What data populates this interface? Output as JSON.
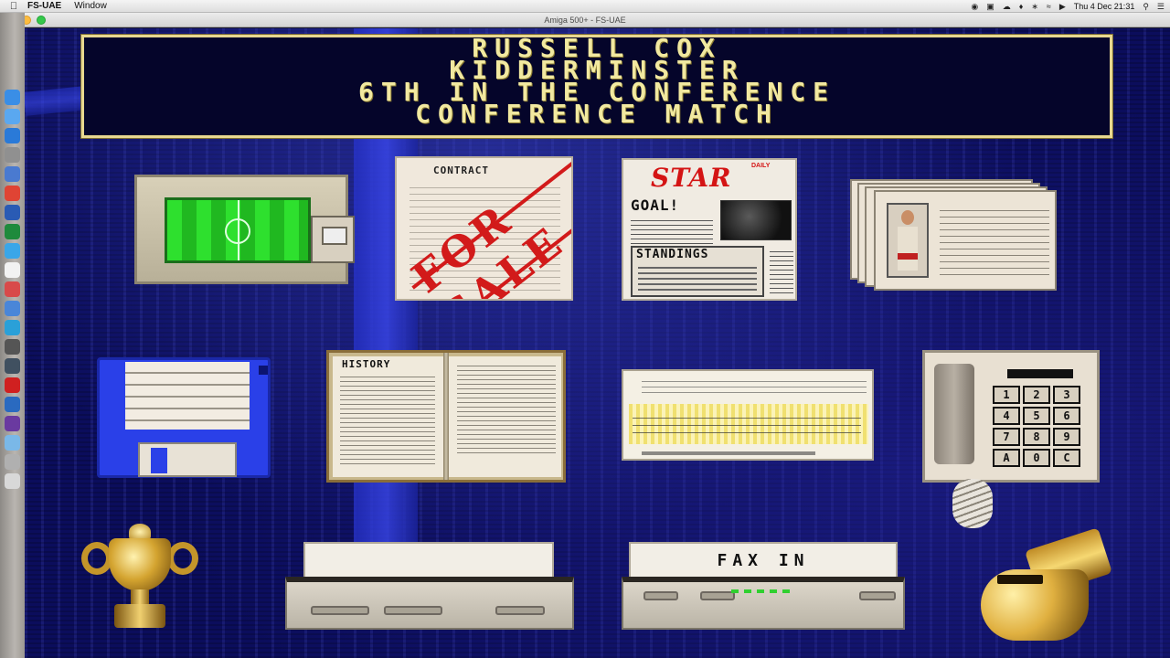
{
  "menubar": {
    "app_name": "FS-UAE",
    "items": [
      "Window"
    ],
    "clock": "Thu 4 Dec  21:31"
  },
  "window": {
    "title": "Amiga 500+ - FS-UAE"
  },
  "game": {
    "header_lines": [
      "RUSSELL COX",
      "KIDDERMINSTER",
      "6TH IN THE CONFERENCE",
      "CONFERENCE MATCH"
    ],
    "contract_heading": "CONTRACT",
    "contract_stamp": "FOR SALE",
    "newspaper_title": "STAR",
    "newspaper_daily": "DAILY",
    "newspaper_headline": "GOAL!",
    "newspaper_section": "STANDINGS",
    "history_heading": "HISTORY",
    "fax_label": "FAX IN",
    "phone_keys": [
      "1",
      "2",
      "3",
      "4",
      "5",
      "6",
      "7",
      "8",
      "9",
      "A",
      "0",
      "C"
    ]
  },
  "dock_icons": [
    "finder-icon",
    "safari-icon",
    "appstore-icon",
    "chrome-icon",
    "word-icon",
    "excel-icon",
    "twitter-icon",
    "mail-icon",
    "opera-icon",
    "pencil-icon",
    "folder-icon",
    "trash-icon"
  ]
}
